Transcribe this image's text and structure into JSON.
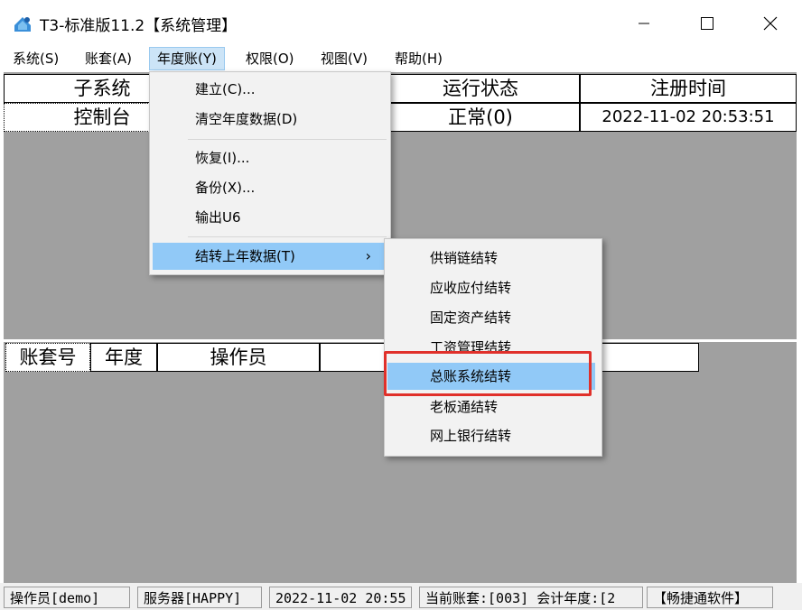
{
  "window": {
    "title": "T3-标准版11.2【系统管理】",
    "controls": {
      "minimize": "—",
      "maximize": "☐",
      "close": "✕"
    }
  },
  "menubar": {
    "items": [
      {
        "label": "系统(S)"
      },
      {
        "label": "账套(A)"
      },
      {
        "label": "年度账(Y)",
        "active": true
      },
      {
        "label": "权限(O)"
      },
      {
        "label": "视图(V)"
      },
      {
        "label": "帮助(H)"
      }
    ]
  },
  "top_table": {
    "headers": [
      "子系统",
      "运行状态",
      "注册时间"
    ],
    "row": [
      "控制台",
      "正常(0)",
      "2022-11-02 20:53:51"
    ]
  },
  "bottom_table": {
    "headers": [
      "账套号",
      "年度",
      "操作员"
    ]
  },
  "year_menu": {
    "items": [
      {
        "label": "建立(C)..."
      },
      {
        "label": "清空年度数据(D)"
      },
      {
        "label": "恢复(I)..."
      },
      {
        "label": "备份(X)..."
      },
      {
        "label": "输出U6"
      },
      {
        "label": "结转上年数据(T)",
        "arrow": "›",
        "highlighted": true
      }
    ]
  },
  "submenu": {
    "items": [
      {
        "label": "供销链结转"
      },
      {
        "label": "应收应付结转"
      },
      {
        "label": "固定资产结转"
      },
      {
        "label": "工资管理结转"
      },
      {
        "label": "总账系统结转",
        "highlighted": true
      },
      {
        "label": "老板通结转"
      },
      {
        "label": "网上银行结转"
      }
    ]
  },
  "statusbar": {
    "operator": "操作员[demo]",
    "server": "服务器[HAPPY]",
    "datetime": "2022-11-02 20:55",
    "account": "当前账套:[003] 会计年度:[2",
    "company": "【畅捷通软件】"
  },
  "colors": {
    "menu_highlight": "#91c9f7",
    "annotation_box": "#e0302a",
    "client_bg": "#a0a0a0"
  }
}
